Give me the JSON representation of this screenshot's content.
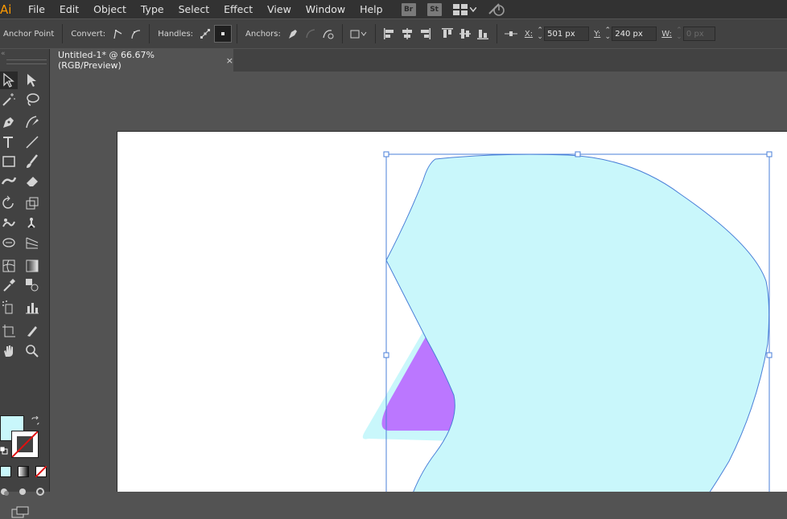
{
  "app": {
    "logo": "Ai"
  },
  "menu": [
    "File",
    "Edit",
    "Object",
    "Type",
    "Select",
    "Effect",
    "View",
    "Window",
    "Help"
  ],
  "menu_extras": {
    "bridge": "Br",
    "stock": "St"
  },
  "control_bar": {
    "mode_label": "Anchor Point",
    "convert_label": "Convert:",
    "handles_label": "Handles:",
    "anchors_label": "Anchors:",
    "x_label": "X:",
    "x_value": "501 px",
    "y_label": "Y:",
    "y_value": "240 px",
    "w_label": "W:",
    "w_value": "0 px"
  },
  "document_tab": {
    "title": "Untitled-1* @ 66.67% (RGB/Preview)",
    "close": "×"
  },
  "colors": {
    "fill": "#c9f7fb",
    "shape_fill": "#c9f7fb",
    "accent_shape": "#bb77ff",
    "selection": "#4a7fd8",
    "logo": "#ff9a00"
  },
  "icons": {
    "tools": [
      "direct-selection-icon",
      "selection-icon",
      "magic-wand-icon",
      "lasso-icon",
      "pen-icon",
      "curvature-icon",
      "type-icon",
      "line-segment-icon",
      "rectangle-icon",
      "paintbrush-icon",
      "shaper-icon",
      "eraser-icon",
      "rotate-icon",
      "scale-icon",
      "warp-icon",
      "puppet-warp-icon",
      "free-transform-icon",
      "perspective-grid-icon",
      "mesh-icon",
      "gradient-icon",
      "eyedropper-icon",
      "blend-icon",
      "symbol-sprayer-icon",
      "column-graph-icon",
      "artboard-icon",
      "slice-icon",
      "hand-icon",
      "zoom-icon"
    ]
  }
}
